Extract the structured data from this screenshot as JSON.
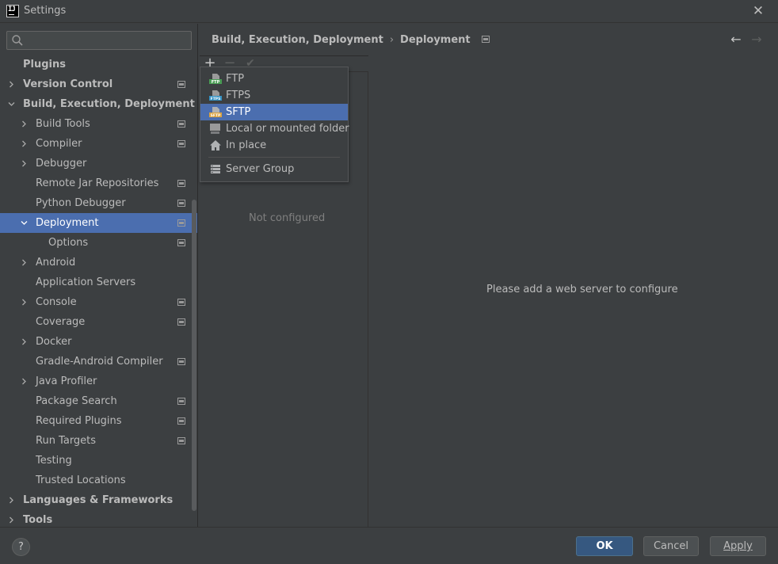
{
  "window": {
    "title": "Settings",
    "close_icon": "close-icon"
  },
  "search": {
    "placeholder": "",
    "value": ""
  },
  "sidebar": {
    "items": [
      {
        "label": "Plugins",
        "level": 0,
        "bold": true,
        "arrow": "none",
        "project": false,
        "selected": false
      },
      {
        "label": "Version Control",
        "level": 0,
        "bold": true,
        "arrow": "right",
        "project": true,
        "selected": false
      },
      {
        "label": "Build, Execution, Deployment",
        "level": 0,
        "bold": true,
        "arrow": "down",
        "project": false,
        "selected": false
      },
      {
        "label": "Build Tools",
        "level": 1,
        "bold": false,
        "arrow": "right",
        "project": true,
        "selected": false
      },
      {
        "label": "Compiler",
        "level": 1,
        "bold": false,
        "arrow": "right",
        "project": true,
        "selected": false
      },
      {
        "label": "Debugger",
        "level": 1,
        "bold": false,
        "arrow": "right",
        "project": false,
        "selected": false
      },
      {
        "label": "Remote Jar Repositories",
        "level": 1,
        "bold": false,
        "arrow": "none",
        "project": true,
        "selected": false
      },
      {
        "label": "Python Debugger",
        "level": 1,
        "bold": false,
        "arrow": "none",
        "project": true,
        "selected": false
      },
      {
        "label": "Deployment",
        "level": 1,
        "bold": false,
        "arrow": "down",
        "project": true,
        "selected": true
      },
      {
        "label": "Options",
        "level": 2,
        "bold": false,
        "arrow": "none",
        "project": true,
        "selected": false
      },
      {
        "label": "Android",
        "level": 1,
        "bold": false,
        "arrow": "right",
        "project": false,
        "selected": false
      },
      {
        "label": "Application Servers",
        "level": 1,
        "bold": false,
        "arrow": "none",
        "project": false,
        "selected": false
      },
      {
        "label": "Console",
        "level": 1,
        "bold": false,
        "arrow": "right",
        "project": true,
        "selected": false
      },
      {
        "label": "Coverage",
        "level": 1,
        "bold": false,
        "arrow": "none",
        "project": true,
        "selected": false
      },
      {
        "label": "Docker",
        "level": 1,
        "bold": false,
        "arrow": "right",
        "project": false,
        "selected": false
      },
      {
        "label": "Gradle-Android Compiler",
        "level": 1,
        "bold": false,
        "arrow": "none",
        "project": true,
        "selected": false
      },
      {
        "label": "Java Profiler",
        "level": 1,
        "bold": false,
        "arrow": "right",
        "project": false,
        "selected": false
      },
      {
        "label": "Package Search",
        "level": 1,
        "bold": false,
        "arrow": "none",
        "project": true,
        "selected": false
      },
      {
        "label": "Required Plugins",
        "level": 1,
        "bold": false,
        "arrow": "none",
        "project": true,
        "selected": false
      },
      {
        "label": "Run Targets",
        "level": 1,
        "bold": false,
        "arrow": "none",
        "project": true,
        "selected": false
      },
      {
        "label": "Testing",
        "level": 1,
        "bold": false,
        "arrow": "none",
        "project": false,
        "selected": false
      },
      {
        "label": "Trusted Locations",
        "level": 1,
        "bold": false,
        "arrow": "none",
        "project": false,
        "selected": false
      },
      {
        "label": "Languages & Frameworks",
        "level": 0,
        "bold": true,
        "arrow": "right",
        "project": false,
        "selected": false
      },
      {
        "label": "Tools",
        "level": 0,
        "bold": true,
        "arrow": "right",
        "project": false,
        "selected": false
      }
    ]
  },
  "breadcrumb": {
    "parent": "Build, Execution, Deployment",
    "separator": "›",
    "current": "Deployment"
  },
  "nav": {
    "back": "←",
    "forward": "→"
  },
  "toolbar": {
    "add": "+",
    "remove": "−",
    "check": "✔"
  },
  "server_list": {
    "empty_text": "Not configured"
  },
  "main": {
    "empty_message": "Please add a web server to configure"
  },
  "add_menu": {
    "items": [
      {
        "label": "FTP",
        "icon": "ftp-icon",
        "selected": false
      },
      {
        "label": "FTPS",
        "icon": "ftps-icon",
        "selected": false
      },
      {
        "label": "SFTP",
        "icon": "sftp-icon",
        "selected": true
      },
      {
        "label": "Local or mounted folder",
        "icon": "folder-icon",
        "selected": false
      },
      {
        "label": "In place",
        "icon": "home-icon",
        "selected": false
      },
      {
        "label": "Server Group",
        "icon": "server-group-icon",
        "selected": false
      }
    ]
  },
  "footer": {
    "help": "?",
    "ok": "OK",
    "cancel": "Cancel",
    "apply": "Apply"
  },
  "colors": {
    "background": "#3c3f41",
    "selection": "#4b6eaf",
    "ok_button": "#365880",
    "text": "#bbbbbb"
  }
}
